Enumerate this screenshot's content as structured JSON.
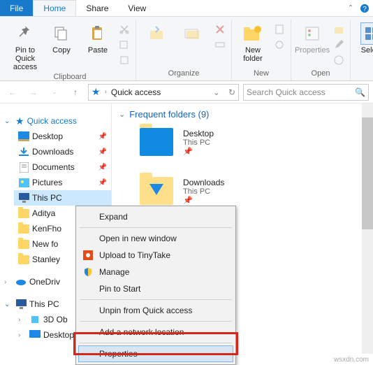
{
  "tabs": {
    "file": "File",
    "home": "Home",
    "share": "Share",
    "view": "View"
  },
  "ribbon": {
    "pin": "Pin to Quick\naccess",
    "copy": "Copy",
    "paste": "Paste",
    "clipboard": "Clipboard",
    "organize": "Organize",
    "newFolder": "New\nfolder",
    "new": "New",
    "properties": "Properties",
    "open": "Open",
    "select": "Select"
  },
  "addr": {
    "location": "Quick access",
    "searchPlaceholder": "Search Quick access"
  },
  "tree": {
    "quick": "Quick access",
    "items": [
      "Desktop",
      "Downloads",
      "Documents",
      "Pictures",
      "This PC",
      "Aditya",
      "KenFho",
      "New fo",
      "Stanley"
    ],
    "onedrive": "OneDriv",
    "thispc": "This PC",
    "pcitems": [
      "3D Ob",
      "Desktop"
    ]
  },
  "section": {
    "title": "Frequent folders (9)"
  },
  "folders": [
    {
      "name": "Desktop",
      "loc": "This PC"
    },
    {
      "name": "Downloads",
      "loc": "This PC"
    }
  ],
  "ctx": {
    "expand": "Expand",
    "openNew": "Open in new window",
    "tiny": "Upload to TinyTake",
    "manage": "Manage",
    "pinStart": "Pin to Start",
    "unpin": "Unpin from Quick access",
    "addNet": "Add a network location",
    "props": "Properties"
  },
  "footer": "wsxdn.com"
}
